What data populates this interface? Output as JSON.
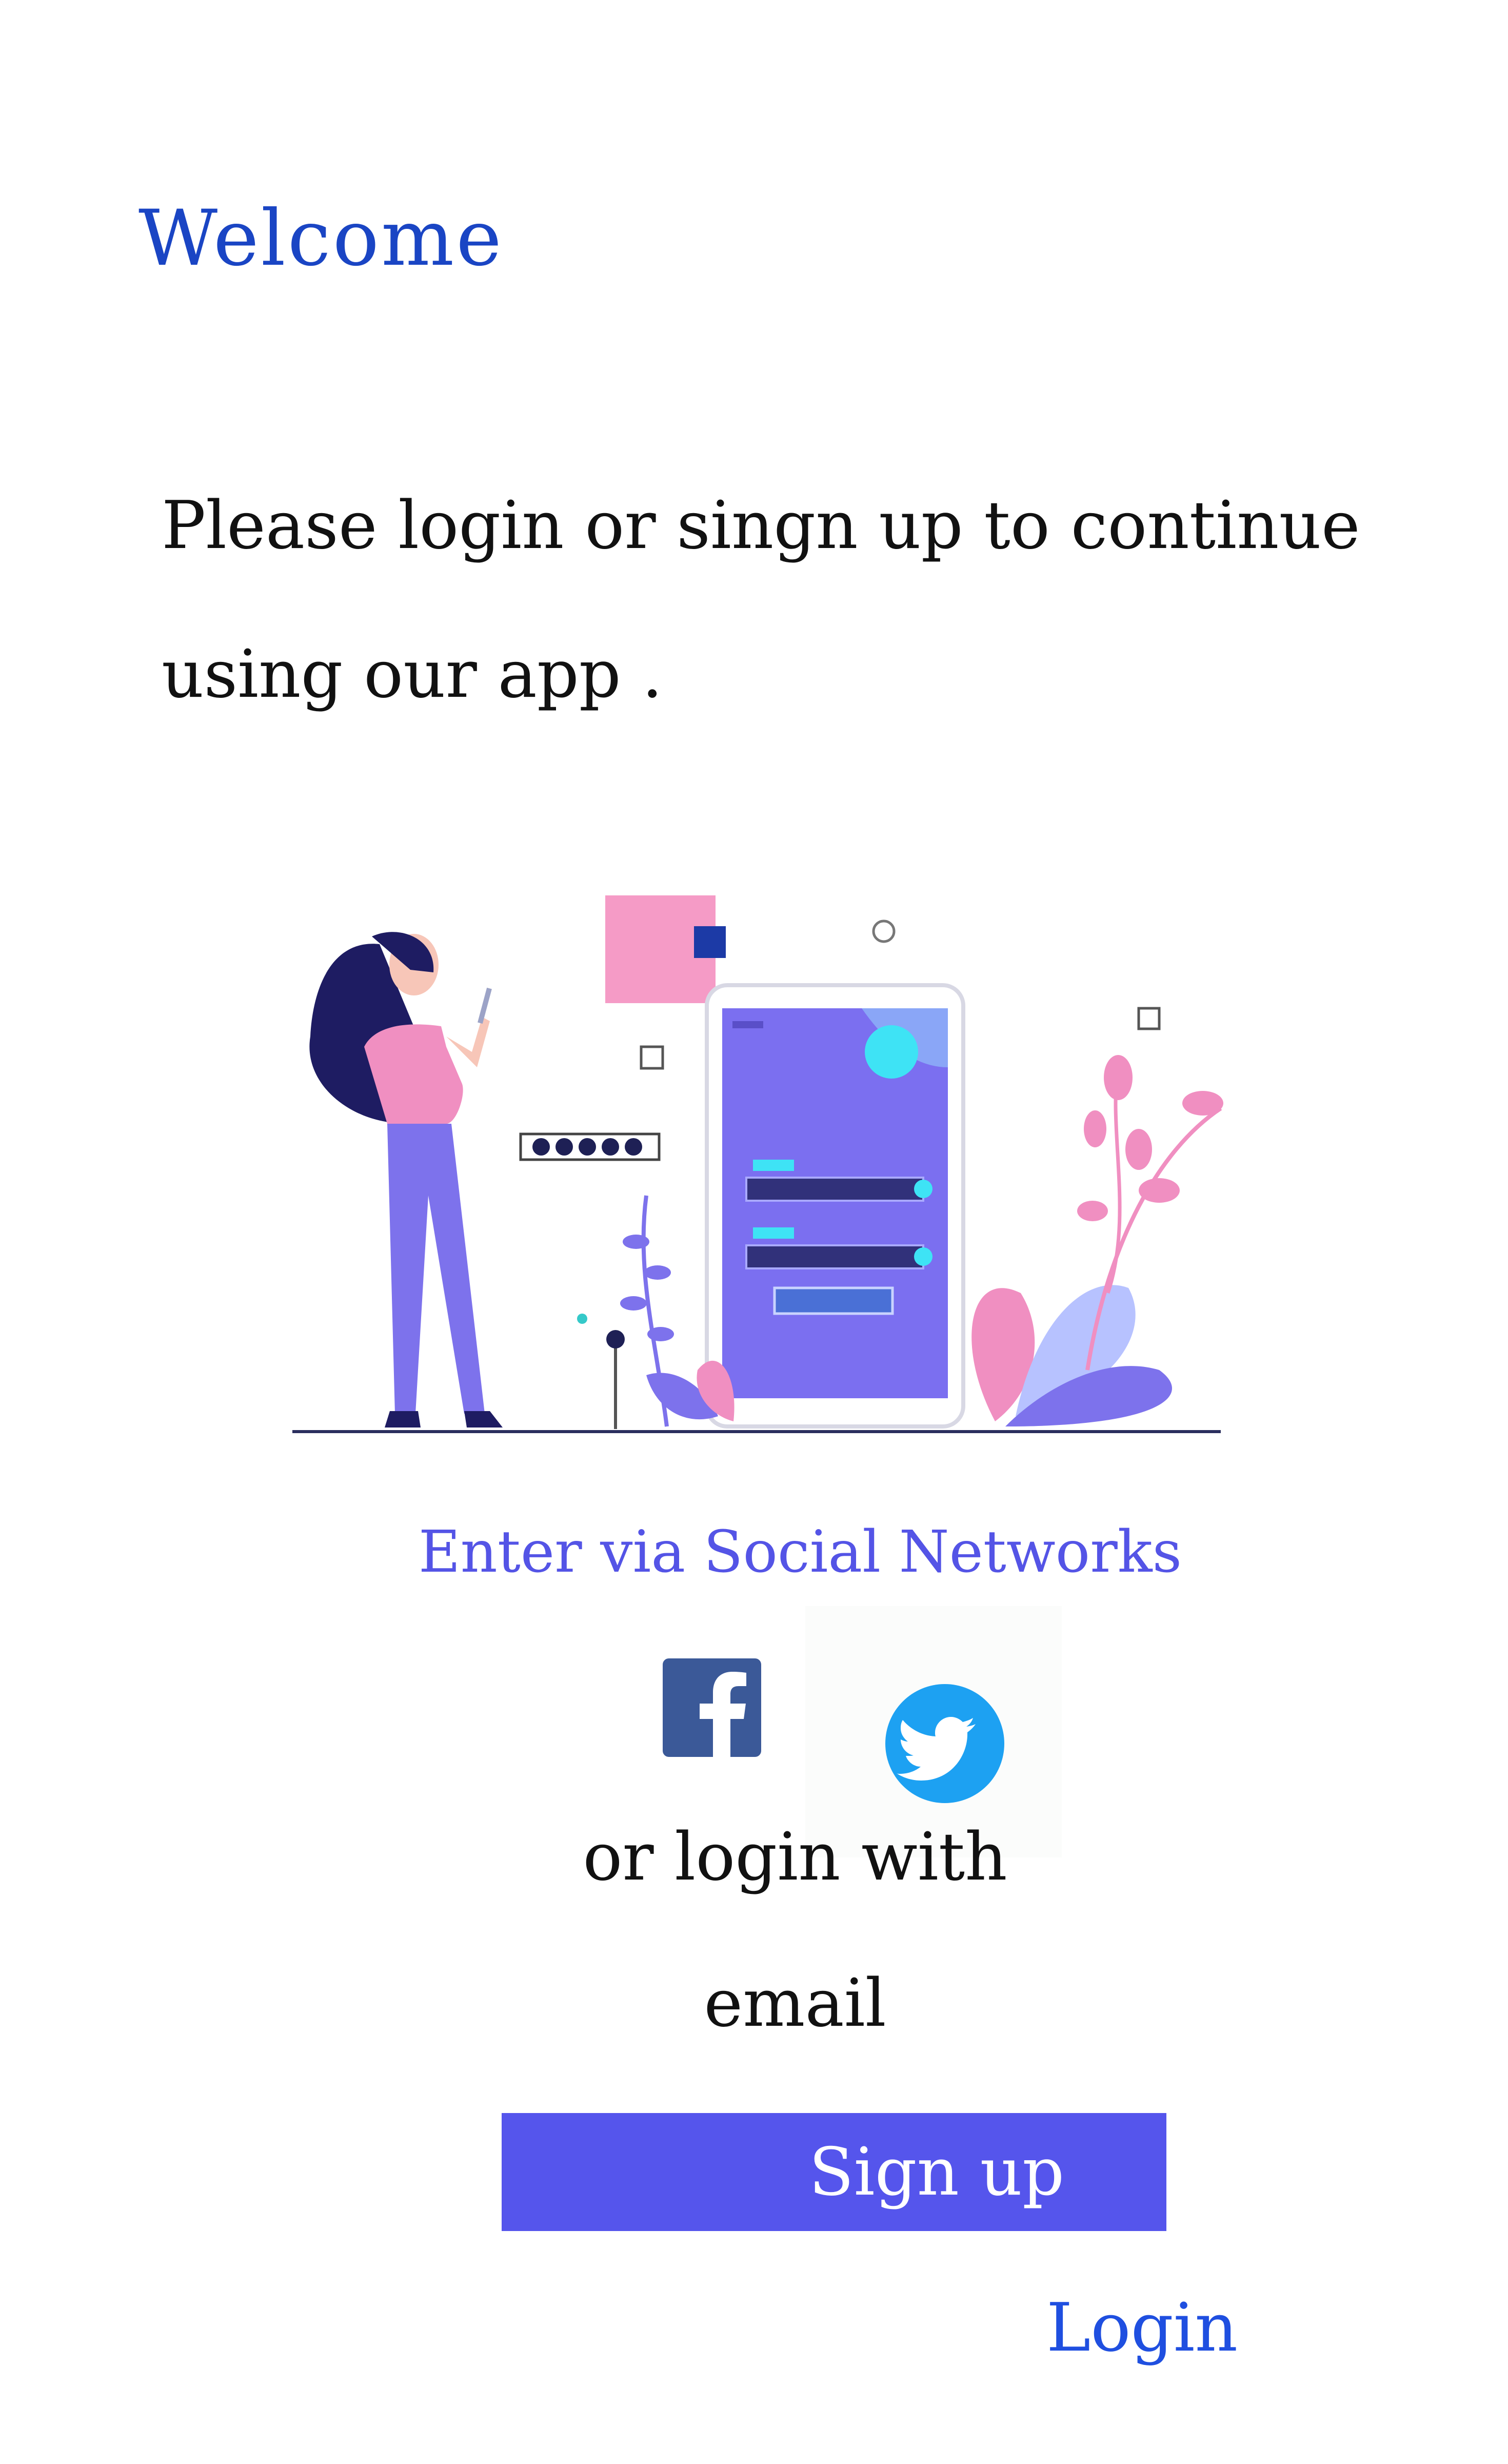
{
  "header": {
    "title": "Welcome"
  },
  "intro": {
    "text": "Please login or singn up to continue using our app ."
  },
  "social": {
    "title": "Enter via Social Networks",
    "facebook_icon": "facebook-icon",
    "twitter_icon": "twitter-icon"
  },
  "email_section": {
    "or_label": "or login with",
    "email_label": "email"
  },
  "actions": {
    "signup_label": "Sign up",
    "login_label": "Login"
  },
  "colors": {
    "title": "#1a45c4",
    "accent": "#5555ec",
    "link": "#1f4fe0",
    "facebook": "#3b5998",
    "twitter": "#1da1f2"
  }
}
